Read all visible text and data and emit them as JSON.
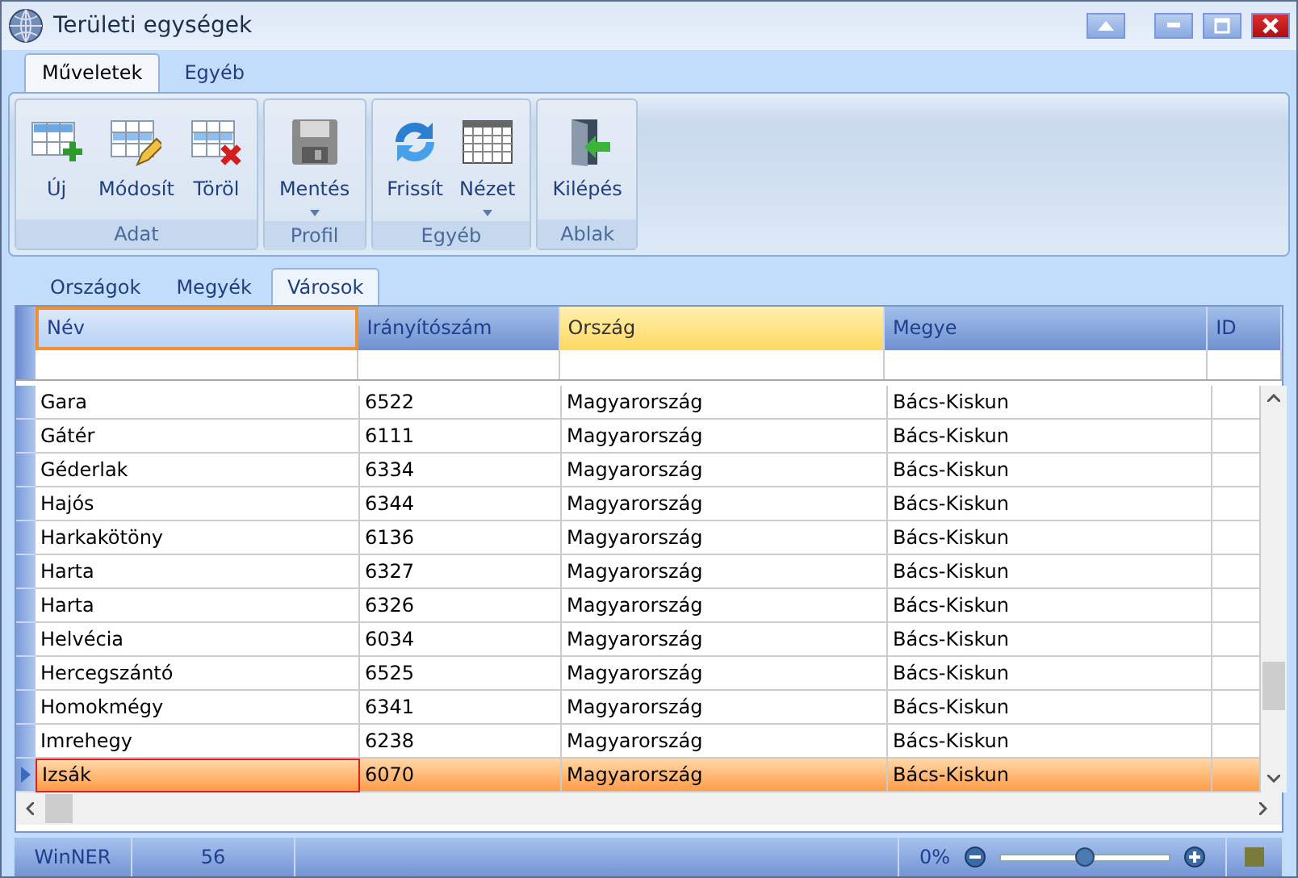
{
  "window": {
    "title": "Területi egységek"
  },
  "ribbon_tabs": [
    {
      "label": "Műveletek",
      "selected": true
    },
    {
      "label": "Egyéb",
      "selected": false
    }
  ],
  "ribbon_groups": [
    {
      "label": "Adat",
      "buttons": [
        {
          "kind": "new",
          "label": "Új",
          "dropdown": false
        },
        {
          "kind": "edit",
          "label": "Módosít",
          "dropdown": false
        },
        {
          "kind": "delete",
          "label": "Töröl",
          "dropdown": false
        }
      ]
    },
    {
      "label": "Profil",
      "buttons": [
        {
          "kind": "save",
          "label": "Mentés",
          "dropdown": true
        }
      ]
    },
    {
      "label": "Egyéb",
      "buttons": [
        {
          "kind": "refresh",
          "label": "Frissít",
          "dropdown": false
        },
        {
          "kind": "view",
          "label": "Nézet",
          "dropdown": true
        }
      ]
    },
    {
      "label": "Ablak",
      "buttons": [
        {
          "kind": "exit",
          "label": "Kilépés",
          "dropdown": false
        }
      ]
    }
  ],
  "view_tabs": [
    {
      "label": "Országok",
      "selected": false
    },
    {
      "label": "Megyék",
      "selected": false
    },
    {
      "label": "Városok",
      "selected": true
    }
  ],
  "table": {
    "columns": [
      {
        "label": "Név",
        "focused": true,
        "highlighted": false
      },
      {
        "label": "Irányítószám",
        "focused": false,
        "highlighted": false
      },
      {
        "label": "Ország",
        "focused": false,
        "highlighted": true
      },
      {
        "label": "Megye",
        "focused": false,
        "highlighted": false
      },
      {
        "label": "ID",
        "focused": false,
        "highlighted": false
      }
    ],
    "rows": [
      {
        "cells": [
          "Gara",
          "6522",
          "Magyarország",
          "Bács-Kiskun"
        ],
        "selected": false
      },
      {
        "cells": [
          "Gátér",
          "6111",
          "Magyarország",
          "Bács-Kiskun"
        ],
        "selected": false
      },
      {
        "cells": [
          "Géderlak",
          "6334",
          "Magyarország",
          "Bács-Kiskun"
        ],
        "selected": false
      },
      {
        "cells": [
          "Hajós",
          "6344",
          "Magyarország",
          "Bács-Kiskun"
        ],
        "selected": false
      },
      {
        "cells": [
          "Harkakötöny",
          "6136",
          "Magyarország",
          "Bács-Kiskun"
        ],
        "selected": false
      },
      {
        "cells": [
          "Harta",
          "6327",
          "Magyarország",
          "Bács-Kiskun"
        ],
        "selected": false
      },
      {
        "cells": [
          "Harta",
          "6326",
          "Magyarország",
          "Bács-Kiskun"
        ],
        "selected": false
      },
      {
        "cells": [
          "Helvécia",
          "6034",
          "Magyarország",
          "Bács-Kiskun"
        ],
        "selected": false
      },
      {
        "cells": [
          "Hercegszántó",
          "6525",
          "Magyarország",
          "Bács-Kiskun"
        ],
        "selected": false
      },
      {
        "cells": [
          "Homokmégy",
          "6341",
          "Magyarország",
          "Bács-Kiskun"
        ],
        "selected": false
      },
      {
        "cells": [
          "Imrehegy",
          "6238",
          "Magyarország",
          "Bács-Kiskun"
        ],
        "selected": false
      },
      {
        "cells": [
          "Izsák",
          "6070",
          "Magyarország",
          "Bács-Kiskun"
        ],
        "selected": true
      }
    ]
  },
  "status_bar": {
    "app": "WinNER",
    "count": "56",
    "zoom": "0%",
    "zoom_slider": {
      "level": 0.5
    },
    "indicator": {
      "color": "#7a7a3a"
    }
  }
}
